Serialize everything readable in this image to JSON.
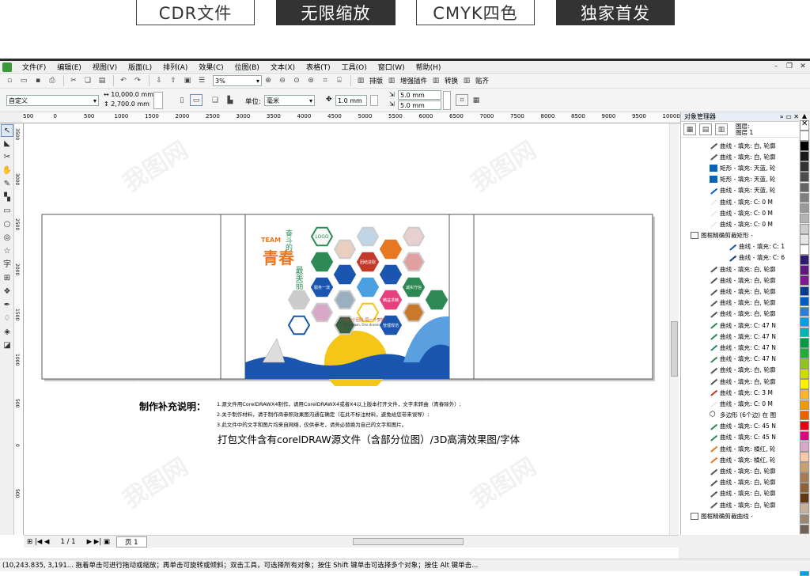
{
  "banner": {
    "tags": [
      "CDR文件",
      "无限缩放",
      "CMYK四色",
      "独家首发"
    ]
  },
  "menu": {
    "items": [
      "文件(F)",
      "编辑(E)",
      "视图(V)",
      "版面(L)",
      "排列(A)",
      "效果(C)",
      "位图(B)",
      "文本(X)",
      "表格(T)",
      "工具(O)",
      "窗口(W)",
      "帮助(H)"
    ]
  },
  "toolbar": {
    "zoom": "3%",
    "btn_layout": "排版",
    "btn_plugin": "增强插件",
    "btn_convert": "转换",
    "btn_paste": "贴齐"
  },
  "propbar": {
    "preset": "自定义",
    "width": "10,000.0 mm",
    "height": "2,700.0 mm",
    "unit_label": "单位:",
    "unit": "毫米",
    "nudge": "1.0 mm",
    "dup_x": "5.0 mm",
    "dup_y": "5.0 mm"
  },
  "ruler": {
    "h_ticks": [
      "500",
      "0",
      "500",
      "1000",
      "1500",
      "2000",
      "2500",
      "3000",
      "3500",
      "4000",
      "4500",
      "5000",
      "5500",
      "6000",
      "6500",
      "7000",
      "7500",
      "8000",
      "8500",
      "9000",
      "9500",
      "10000",
      "1050"
    ],
    "v_ticks": [
      "3500",
      "3000",
      "2500",
      "2000",
      "1500",
      "1000",
      "500",
      "0",
      "500"
    ]
  },
  "design": {
    "team": "TEAM",
    "slogan_small": "奋斗的",
    "slogan_big": "青春",
    "slogan_tail": "最美丽",
    "hex_labels": [
      "LOGO",
      "团结进取",
      "服务一流",
      "精益求精",
      "诚实守信",
      "管理规范"
    ],
    "hex_small": "同一个团队 同一个梦想",
    "hex_small_en": "One team, One dream"
  },
  "notes": {
    "title": "制作补充说明：",
    "lines": [
      "1.源文件用CorelDRAWX4制作，请用CorelDRAWX4或者X4以上版本打开文件，文字未转曲（青春除外）;",
      "2.关于制作材料，请于制作商参照效果图沟通在确定（在此不标注材料，避免给您带来误导）;",
      "3.此文件中的文字和图片均来自网络，仅供参考，请务必替换为自己的文字和图片。"
    ],
    "pack": "打包文件含有corelDRAW源文件（含部分位图）/3D高清效果图/字体"
  },
  "object_manager": {
    "title": "对象管理器",
    "layer": "图层:",
    "layer_name": "图层 1",
    "rows": [
      {
        "t": "曲线 - 填充: 白, 轮廓",
        "c": "#ffffff",
        "s": "curve",
        "indent": 3
      },
      {
        "t": "曲线 - 填充: 白, 轮廓",
        "c": "#ffffff",
        "s": "curve",
        "indent": 3
      },
      {
        "t": "矩形 - 填充: 天蓝, 轮",
        "c": "#0b63b5",
        "s": "rect",
        "indent": 3
      },
      {
        "t": "矩形 - 填充: 天蓝, 轮",
        "c": "#0b63b5",
        "s": "rect",
        "indent": 3
      },
      {
        "t": "曲线 - 填充: 天蓝, 轮",
        "c": "#0b63b5",
        "s": "curve",
        "indent": 3
      },
      {
        "t": "曲线 - 填充: C: 0 M",
        "c": "#f3e8e8",
        "s": "curve",
        "indent": 3
      },
      {
        "t": "曲线 - 填充: C: 0 M",
        "c": "#f3e8e8",
        "s": "curve",
        "indent": 3
      },
      {
        "t": "曲线 - 填充: C: 0 M",
        "c": "#f3e8e8",
        "s": "curve",
        "indent": 3
      },
      {
        "t": "图框精确剪裁矩形 -",
        "c": "#ffffff",
        "s": "group",
        "indent": 1
      },
      {
        "t": "曲线 - 填充: C: 1",
        "c": "#1a56b0",
        "s": "curve",
        "indent": 5
      },
      {
        "t": "曲线 - 填充: C: 6",
        "c": "#1a3a70",
        "s": "curve",
        "indent": 5
      },
      {
        "t": "曲线 - 填充: 白, 轮廓",
        "c": "#ffffff",
        "s": "curve",
        "indent": 3
      },
      {
        "t": "曲线 - 填充: 白, 轮廓",
        "c": "#ffffff",
        "s": "curve",
        "indent": 3
      },
      {
        "t": "曲线 - 填充: 白, 轮廓",
        "c": "#ffffff",
        "s": "curve",
        "indent": 3
      },
      {
        "t": "曲线 - 填充: 白, 轮廓",
        "c": "#ffffff",
        "s": "curve",
        "indent": 3
      },
      {
        "t": "曲线 - 填充: 白, 轮廓",
        "c": "#ffffff",
        "s": "curve",
        "indent": 3
      },
      {
        "t": "曲线 - 填充: C: 47 N",
        "c": "#2d8a55",
        "s": "curve",
        "indent": 3
      },
      {
        "t": "曲线 - 填充: C: 47 N",
        "c": "#2d8a55",
        "s": "curve",
        "indent": 3
      },
      {
        "t": "曲线 - 填充: C: 47 N",
        "c": "#2d8a55",
        "s": "curve",
        "indent": 3
      },
      {
        "t": "曲线 - 填充: C: 47 N",
        "c": "#2d8a55",
        "s": "curve",
        "indent": 3
      },
      {
        "t": "曲线 - 填充: 白, 轮廓",
        "c": "#ffffff",
        "s": "curve",
        "indent": 3
      },
      {
        "t": "曲线 - 填充: 白, 轮廓",
        "c": "#ffffff",
        "s": "curve",
        "indent": 3
      },
      {
        "t": "曲线 - 填充: C: 3 M",
        "c": "#c43a2a",
        "s": "curve",
        "indent": 3
      },
      {
        "t": "曲线 - 填充: C: 0 M",
        "c": "#f3e8e8",
        "s": "curve",
        "indent": 3
      },
      {
        "t": "多边形 (6个边) 在 图",
        "c": "#cccccc",
        "s": "poly",
        "indent": 3
      },
      {
        "t": "曲线 - 填充: C: 45 N",
        "c": "#2d8a55",
        "s": "curve",
        "indent": 3
      },
      {
        "t": "曲线 - 填充: C: 45 N",
        "c": "#2d8a55",
        "s": "curve",
        "indent": 3
      },
      {
        "t": "曲线 - 填充: 橘红, 轮",
        "c": "#e87722",
        "s": "curve",
        "indent": 3
      },
      {
        "t": "曲线 - 填充: 橘红, 轮",
        "c": "#e87722",
        "s": "curve",
        "indent": 3
      },
      {
        "t": "曲线 - 填充: 白, 轮廓",
        "c": "#ffffff",
        "s": "curve",
        "indent": 3
      },
      {
        "t": "曲线 - 填充: 白, 轮廓",
        "c": "#ffffff",
        "s": "curve",
        "indent": 3
      },
      {
        "t": "曲线 - 填充: 白, 轮廓",
        "c": "#ffffff",
        "s": "curve",
        "indent": 3
      },
      {
        "t": "曲线 - 填充: 白, 轮廓",
        "c": "#ffffff",
        "s": "curve",
        "indent": 3
      },
      {
        "t": "图框精确剪裁曲线 -",
        "c": "#ffffff",
        "s": "group",
        "indent": 1
      }
    ]
  },
  "palette": [
    "#ffffff",
    "#000000",
    "#1a1a1a",
    "#333333",
    "#4d4d4d",
    "#666666",
    "#808080",
    "#999999",
    "#b3b3b3",
    "#cccccc",
    "#e6e6e6",
    "#ffffff",
    "#2e1a6e",
    "#5a1a7e",
    "#7e1a8e",
    "#003b8e",
    "#005cbf",
    "#2d7cd6",
    "#00a0e9",
    "#00b5b5",
    "#009944",
    "#22ac38",
    "#8fc31f",
    "#cfdb00",
    "#fff100",
    "#f8b62d",
    "#f39800",
    "#eb6100",
    "#e60012",
    "#e4007f",
    "#d7a8c8",
    "#f5c8a8",
    "#c8a26e",
    "#a67c52",
    "#8c6239",
    "#603813",
    "#c7b299",
    "#998675",
    "#736357",
    "#534741",
    "#c2e0f2",
    "#7ecef4",
    "#00a0e9"
  ],
  "pagebar": {
    "pages": "1 / 1",
    "tab": "页 1"
  },
  "status": {
    "text": "(10,243.835, 3,191... 拖着单击可进行拖动或缩放；再单击可旋转或倾斜；双击工具，可选择所有对象；按住 Shift 键单击可选择多个对象；按住 Alt 键单击..."
  }
}
